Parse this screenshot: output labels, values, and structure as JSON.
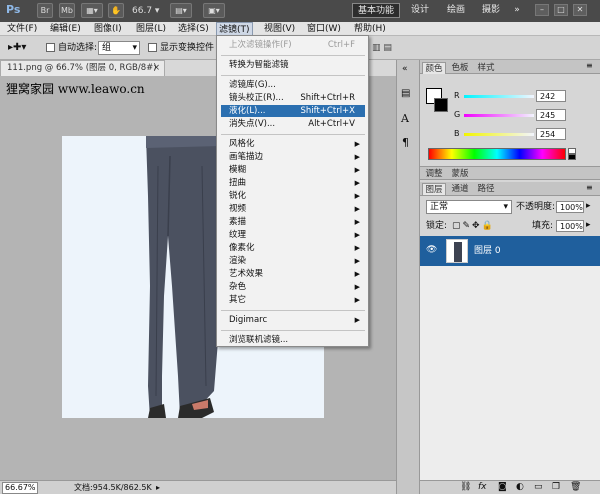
{
  "app": {
    "logo": "Ps",
    "toolbar_buttons": [
      "Br",
      "Mb"
    ],
    "zoom": "66.7",
    "workspaces": [
      "基本功能",
      "设计",
      "绘画",
      "摄影"
    ],
    "window_controls": [
      "–",
      "□",
      "✕"
    ]
  },
  "menubar": [
    "文件(F)",
    "编辑(E)",
    "图像(I)",
    "图层(L)",
    "选择(S)",
    "滤镜(T)",
    "视图(V)",
    "窗口(W)",
    "帮助(H)"
  ],
  "options": {
    "auto_select_label": "自动选择:",
    "auto_select_value": "组",
    "show_transform_label": "显示变换控件"
  },
  "document": {
    "tab_title": "111.png @ 66.7% (图层 0, RGB/8#)",
    "tab_close": "×",
    "watermark": "狸窝家园  www.leawo.cn",
    "zoom_status": "66.67%",
    "doc_size": "文档:954.5K/862.5K"
  },
  "filter_menu": {
    "items": [
      {
        "label": "上次滤镜操作(F)",
        "shortcut": "Ctrl+F",
        "disabled": true
      },
      {
        "sep": true
      },
      {
        "label": "转换为智能滤镜"
      },
      {
        "sep": true
      },
      {
        "label": "滤镜库(G)..."
      },
      {
        "label": "镜头校正(R)...",
        "shortcut": "Shift+Ctrl+R"
      },
      {
        "label": "液化(L)...",
        "shortcut": "Shift+Ctrl+X",
        "highlight": true
      },
      {
        "label": "消失点(V)...",
        "shortcut": "Alt+Ctrl+V"
      },
      {
        "sep": true
      },
      {
        "label": "风格化",
        "sub": true
      },
      {
        "label": "画笔描边",
        "sub": true
      },
      {
        "label": "模糊",
        "sub": true
      },
      {
        "label": "扭曲",
        "sub": true
      },
      {
        "label": "锐化",
        "sub": true
      },
      {
        "label": "视频",
        "sub": true
      },
      {
        "label": "素描",
        "sub": true
      },
      {
        "label": "纹理",
        "sub": true
      },
      {
        "label": "像素化",
        "sub": true
      },
      {
        "label": "渲染",
        "sub": true
      },
      {
        "label": "艺术效果",
        "sub": true
      },
      {
        "label": "杂色",
        "sub": true
      },
      {
        "label": "其它",
        "sub": true
      },
      {
        "sep": true
      },
      {
        "label": "Digimarc",
        "sub": true
      },
      {
        "sep": true
      },
      {
        "label": "浏览联机滤镜..."
      }
    ]
  },
  "color_panel": {
    "tabs": [
      "颜色",
      "色板",
      "样式"
    ],
    "channels": [
      {
        "name": "R",
        "value": "242",
        "color": "#f26a6a"
      },
      {
        "name": "G",
        "value": "245",
        "color": "#44d65a"
      },
      {
        "name": "B",
        "value": "254",
        "color": "#4f6df5"
      }
    ]
  },
  "adjust_tabs": [
    "调整",
    "蒙版"
  ],
  "layers_panel": {
    "tabs": [
      "图层",
      "通道",
      "路径"
    ],
    "blend_mode": "正常",
    "opacity_label": "不透明度:",
    "opacity": "100%",
    "lock_label": "锁定:",
    "fill_label": "填充:",
    "fill": "100%",
    "layer_name": "图层 0",
    "footer_icons": [
      "link-icon",
      "fx-icon",
      "mask-icon",
      "adjustment-icon",
      "folder-icon",
      "new-layer-icon",
      "trash-icon"
    ]
  }
}
